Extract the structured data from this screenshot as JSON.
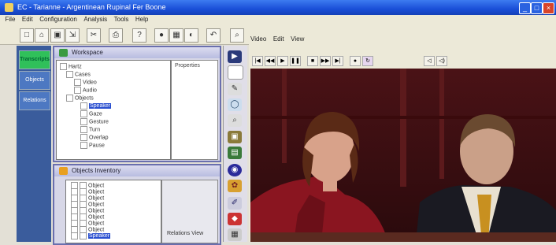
{
  "window": {
    "title": "EC - Tarianne - Argentinean Rupinal Fer Boone",
    "min_label": "_",
    "max_label": "□",
    "close_label": "×"
  },
  "menubar": {
    "items": [
      "File",
      "Edit",
      "Configuration",
      "Analysis",
      "Tools",
      "Help"
    ]
  },
  "toolbar": {
    "icons": [
      "new-icon",
      "open-icon",
      "save-icon",
      "export-icon",
      "cut-icon",
      "print-icon",
      "help-icon",
      "record-icon",
      "grid-icon",
      "palette-icon",
      "undo-icon",
      "zoom-icon"
    ]
  },
  "left_nav": {
    "items": [
      {
        "label": "Transcripts",
        "active": true
      },
      {
        "label": "Objects",
        "active": false
      },
      {
        "label": "Relations",
        "active": false
      }
    ]
  },
  "top_panel": {
    "title": "Workspace",
    "side_title": "Properties",
    "tree": [
      {
        "label": "Hartz",
        "level": 0,
        "selected": false
      },
      {
        "label": "Cases",
        "level": 1,
        "selected": false
      },
      {
        "label": "Video",
        "level": 2,
        "selected": false
      },
      {
        "label": "Audio",
        "level": 2,
        "selected": false
      },
      {
        "label": "Objects",
        "level": 1,
        "selected": false
      },
      {
        "label": "Speaker",
        "level": 2,
        "selected": true
      },
      {
        "label": "Gaze",
        "level": 2,
        "selected": false
      },
      {
        "label": "Gesture",
        "level": 2,
        "selected": false
      },
      {
        "label": "Turn",
        "level": 2,
        "selected": false
      },
      {
        "label": "Overlap",
        "level": 2,
        "selected": false
      },
      {
        "label": "Pause",
        "level": 2,
        "selected": false
      }
    ]
  },
  "bottom_panel": {
    "title": "Objects Inventory",
    "rows": [
      "Object",
      "Object",
      "Object",
      "Object",
      "Object",
      "Object",
      "Object",
      "Object",
      "Object"
    ],
    "selected_row": "Speaker",
    "side_label": "Relations View"
  },
  "icon_strip": {
    "icons": [
      "cursor-icon",
      "blank-icon",
      "pencil-icon",
      "circle-icon",
      "magnifier-icon",
      "image-icon",
      "calendar-icon",
      "globe-icon",
      "palette-icon",
      "brush-icon",
      "grid-icon"
    ]
  },
  "viewer": {
    "menu": [
      "Video",
      "Edit",
      "View"
    ],
    "toolbar_icons": [
      "prev-icon",
      "rewind-icon",
      "play-icon",
      "pause-icon",
      "stop-icon",
      "forward-icon",
      "next-icon",
      "record-icon",
      "loop-icon"
    ]
  },
  "colors": {
    "titlebar": "#1a4fd8",
    "nav_active": "#30c05a",
    "panel_border": "#6a6fae",
    "selection": "#2a4fd0"
  }
}
